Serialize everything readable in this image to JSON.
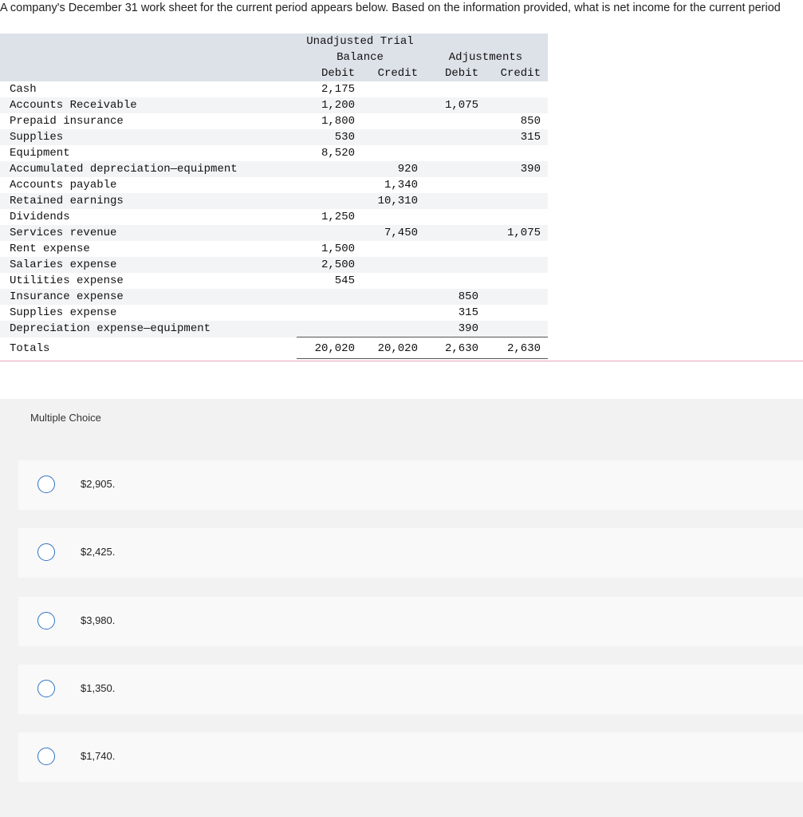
{
  "question": "A company's December 31 work sheet for the current period appears below. Based on the information provided, what is net income for the current period",
  "worksheet": {
    "header": {
      "utb_line1": "Unadjusted Trial",
      "utb_line2": "Balance",
      "adjustments": "Adjustments",
      "debit": "Debit",
      "credit": "Credit"
    },
    "rows": [
      {
        "account": "Cash",
        "utb_debit": "2,175",
        "utb_credit": "",
        "adj_debit": "",
        "adj_credit": ""
      },
      {
        "account": "Accounts Receivable",
        "utb_debit": "1,200",
        "utb_credit": "",
        "adj_debit": "1,075",
        "adj_credit": ""
      },
      {
        "account": "Prepaid insurance",
        "utb_debit": "1,800",
        "utb_credit": "",
        "adj_debit": "",
        "adj_credit": "850"
      },
      {
        "account": "Supplies",
        "utb_debit": "530",
        "utb_credit": "",
        "adj_debit": "",
        "adj_credit": "315"
      },
      {
        "account": "Equipment",
        "utb_debit": "8,520",
        "utb_credit": "",
        "adj_debit": "",
        "adj_credit": ""
      },
      {
        "account": "Accumulated depreciation—equipment",
        "utb_debit": "",
        "utb_credit": "920",
        "adj_debit": "",
        "adj_credit": "390"
      },
      {
        "account": "Accounts payable",
        "utb_debit": "",
        "utb_credit": "1,340",
        "adj_debit": "",
        "adj_credit": ""
      },
      {
        "account": "Retained earnings",
        "utb_debit": "",
        "utb_credit": "10,310",
        "adj_debit": "",
        "adj_credit": ""
      },
      {
        "account": "Dividends",
        "utb_debit": "1,250",
        "utb_credit": "",
        "adj_debit": "",
        "adj_credit": ""
      },
      {
        "account": "Services revenue",
        "utb_debit": "",
        "utb_credit": "7,450",
        "adj_debit": "",
        "adj_credit": "1,075"
      },
      {
        "account": "Rent expense",
        "utb_debit": "1,500",
        "utb_credit": "",
        "adj_debit": "",
        "adj_credit": ""
      },
      {
        "account": "Salaries expense",
        "utb_debit": "2,500",
        "utb_credit": "",
        "adj_debit": "",
        "adj_credit": ""
      },
      {
        "account": "Utilities expense",
        "utb_debit": "545",
        "utb_credit": "",
        "adj_debit": "",
        "adj_credit": ""
      },
      {
        "account": "Insurance expense",
        "utb_debit": "",
        "utb_credit": "",
        "adj_debit": "850",
        "adj_credit": ""
      },
      {
        "account": "Supplies expense",
        "utb_debit": "",
        "utb_credit": "",
        "adj_debit": "315",
        "adj_credit": ""
      },
      {
        "account": "Depreciation expense—equipment",
        "utb_debit": "",
        "utb_credit": "",
        "adj_debit": "390",
        "adj_credit": ""
      }
    ],
    "totals": {
      "label": "Totals",
      "utb_debit": "20,020",
      "utb_credit": "20,020",
      "adj_debit": "2,630",
      "adj_credit": "2,630"
    }
  },
  "multiple_choice": {
    "label": "Multiple Choice",
    "options": [
      "$2,905.",
      "$2,425.",
      "$3,980.",
      "$1,350.",
      "$1,740."
    ]
  }
}
